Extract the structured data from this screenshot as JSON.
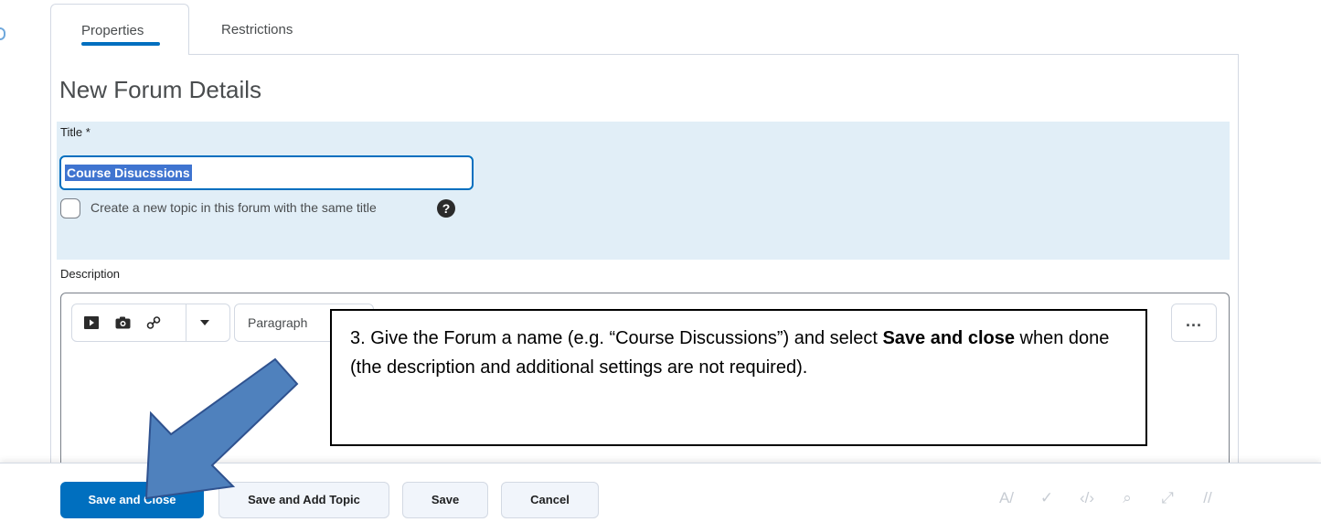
{
  "tabs": [
    {
      "label": "Properties",
      "active": true
    },
    {
      "label": "Restrictions",
      "active": false
    }
  ],
  "page_title": "New Forum Details",
  "title_field": {
    "label": "Title *",
    "value": "Course Disucssions"
  },
  "checkbox": {
    "label": "Create a new topic in this forum with the same title",
    "checked": false
  },
  "help_icon": "?",
  "description": {
    "label": "Description",
    "toolbar": {
      "format_value": "Paragraph",
      "more_label": "..."
    }
  },
  "callout": {
    "text_1": "3. Give the Forum a name (e.g. “Course Discussions”) and select ",
    "bold_1": "Save and close",
    "text_2": " when done (the description and additional settings are not required)."
  },
  "buttons": {
    "save_and_close": "Save and Close",
    "save_and_add_topic": "Save and Add Topic",
    "save": "Save",
    "cancel": "Cancel"
  },
  "icons": {
    "insert": [
      "video-icon",
      "image-icon",
      "link-icon",
      "chevron-down-icon"
    ],
    "status": [
      "spellcheck-icon",
      "accessibility-icon",
      "source-code-icon",
      "preview-icon",
      "fullscreen-icon",
      "resize-handle-icon"
    ]
  },
  "colors": {
    "accent": "#006fbf",
    "title_section_bg": "#e1eef7",
    "arrow_fill": "#4f81bd",
    "arrow_stroke": "#2f528f"
  }
}
